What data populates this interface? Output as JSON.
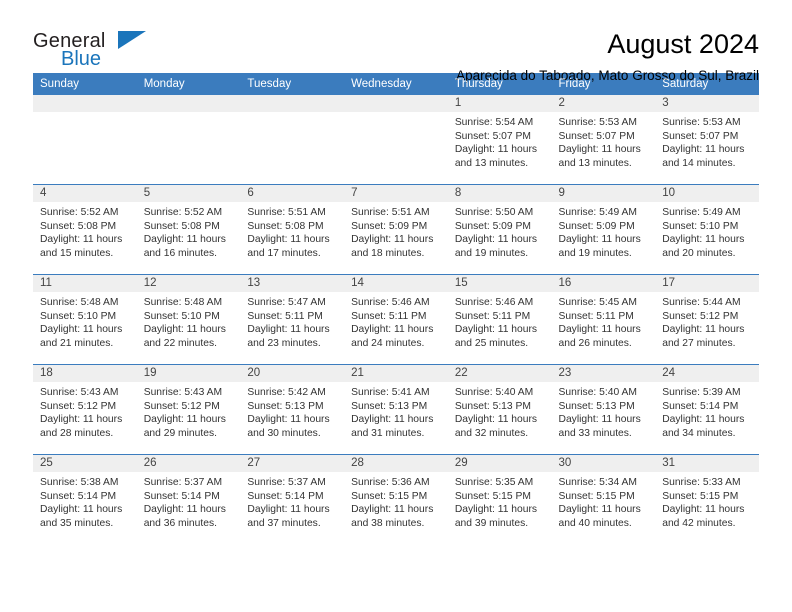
{
  "brand": {
    "word_one": "General",
    "word_two": "Blue",
    "triangle_icon": "triangle-icon"
  },
  "header": {
    "title": "August 2024",
    "subtitle": "Aparecida do Taboado, Mato Grosso do Sul, Brazil"
  },
  "colors": {
    "header_blue": "#3b7cbe",
    "daynum_strip": "#efefef",
    "brand_blue": "#1b75bb",
    "text": "#333333"
  },
  "calendar": {
    "weekday_headers": [
      "Sunday",
      "Monday",
      "Tuesday",
      "Wednesday",
      "Thursday",
      "Friday",
      "Saturday"
    ],
    "weeks": [
      [
        {
          "day": "",
          "empty": true,
          "sunrise": "",
          "sunset": "",
          "daylight_line1": "",
          "daylight_line2": ""
        },
        {
          "day": "",
          "empty": true,
          "sunrise": "",
          "sunset": "",
          "daylight_line1": "",
          "daylight_line2": ""
        },
        {
          "day": "",
          "empty": true,
          "sunrise": "",
          "sunset": "",
          "daylight_line1": "",
          "daylight_line2": ""
        },
        {
          "day": "",
          "empty": true,
          "sunrise": "",
          "sunset": "",
          "daylight_line1": "",
          "daylight_line2": ""
        },
        {
          "day": "1",
          "empty": false,
          "sunrise": "Sunrise: 5:54 AM",
          "sunset": "Sunset: 5:07 PM",
          "daylight_line1": "Daylight: 11 hours",
          "daylight_line2": "and 13 minutes."
        },
        {
          "day": "2",
          "empty": false,
          "sunrise": "Sunrise: 5:53 AM",
          "sunset": "Sunset: 5:07 PM",
          "daylight_line1": "Daylight: 11 hours",
          "daylight_line2": "and 13 minutes."
        },
        {
          "day": "3",
          "empty": false,
          "sunrise": "Sunrise: 5:53 AM",
          "sunset": "Sunset: 5:07 PM",
          "daylight_line1": "Daylight: 11 hours",
          "daylight_line2": "and 14 minutes."
        }
      ],
      [
        {
          "day": "4",
          "empty": false,
          "sunrise": "Sunrise: 5:52 AM",
          "sunset": "Sunset: 5:08 PM",
          "daylight_line1": "Daylight: 11 hours",
          "daylight_line2": "and 15 minutes."
        },
        {
          "day": "5",
          "empty": false,
          "sunrise": "Sunrise: 5:52 AM",
          "sunset": "Sunset: 5:08 PM",
          "daylight_line1": "Daylight: 11 hours",
          "daylight_line2": "and 16 minutes."
        },
        {
          "day": "6",
          "empty": false,
          "sunrise": "Sunrise: 5:51 AM",
          "sunset": "Sunset: 5:08 PM",
          "daylight_line1": "Daylight: 11 hours",
          "daylight_line2": "and 17 minutes."
        },
        {
          "day": "7",
          "empty": false,
          "sunrise": "Sunrise: 5:51 AM",
          "sunset": "Sunset: 5:09 PM",
          "daylight_line1": "Daylight: 11 hours",
          "daylight_line2": "and 18 minutes."
        },
        {
          "day": "8",
          "empty": false,
          "sunrise": "Sunrise: 5:50 AM",
          "sunset": "Sunset: 5:09 PM",
          "daylight_line1": "Daylight: 11 hours",
          "daylight_line2": "and 19 minutes."
        },
        {
          "day": "9",
          "empty": false,
          "sunrise": "Sunrise: 5:49 AM",
          "sunset": "Sunset: 5:09 PM",
          "daylight_line1": "Daylight: 11 hours",
          "daylight_line2": "and 19 minutes."
        },
        {
          "day": "10",
          "empty": false,
          "sunrise": "Sunrise: 5:49 AM",
          "sunset": "Sunset: 5:10 PM",
          "daylight_line1": "Daylight: 11 hours",
          "daylight_line2": "and 20 minutes."
        }
      ],
      [
        {
          "day": "11",
          "empty": false,
          "sunrise": "Sunrise: 5:48 AM",
          "sunset": "Sunset: 5:10 PM",
          "daylight_line1": "Daylight: 11 hours",
          "daylight_line2": "and 21 minutes."
        },
        {
          "day": "12",
          "empty": false,
          "sunrise": "Sunrise: 5:48 AM",
          "sunset": "Sunset: 5:10 PM",
          "daylight_line1": "Daylight: 11 hours",
          "daylight_line2": "and 22 minutes."
        },
        {
          "day": "13",
          "empty": false,
          "sunrise": "Sunrise: 5:47 AM",
          "sunset": "Sunset: 5:11 PM",
          "daylight_line1": "Daylight: 11 hours",
          "daylight_line2": "and 23 minutes."
        },
        {
          "day": "14",
          "empty": false,
          "sunrise": "Sunrise: 5:46 AM",
          "sunset": "Sunset: 5:11 PM",
          "daylight_line1": "Daylight: 11 hours",
          "daylight_line2": "and 24 minutes."
        },
        {
          "day": "15",
          "empty": false,
          "sunrise": "Sunrise: 5:46 AM",
          "sunset": "Sunset: 5:11 PM",
          "daylight_line1": "Daylight: 11 hours",
          "daylight_line2": "and 25 minutes."
        },
        {
          "day": "16",
          "empty": false,
          "sunrise": "Sunrise: 5:45 AM",
          "sunset": "Sunset: 5:11 PM",
          "daylight_line1": "Daylight: 11 hours",
          "daylight_line2": "and 26 minutes."
        },
        {
          "day": "17",
          "empty": false,
          "sunrise": "Sunrise: 5:44 AM",
          "sunset": "Sunset: 5:12 PM",
          "daylight_line1": "Daylight: 11 hours",
          "daylight_line2": "and 27 minutes."
        }
      ],
      [
        {
          "day": "18",
          "empty": false,
          "sunrise": "Sunrise: 5:43 AM",
          "sunset": "Sunset: 5:12 PM",
          "daylight_line1": "Daylight: 11 hours",
          "daylight_line2": "and 28 minutes."
        },
        {
          "day": "19",
          "empty": false,
          "sunrise": "Sunrise: 5:43 AM",
          "sunset": "Sunset: 5:12 PM",
          "daylight_line1": "Daylight: 11 hours",
          "daylight_line2": "and 29 minutes."
        },
        {
          "day": "20",
          "empty": false,
          "sunrise": "Sunrise: 5:42 AM",
          "sunset": "Sunset: 5:13 PM",
          "daylight_line1": "Daylight: 11 hours",
          "daylight_line2": "and 30 minutes."
        },
        {
          "day": "21",
          "empty": false,
          "sunrise": "Sunrise: 5:41 AM",
          "sunset": "Sunset: 5:13 PM",
          "daylight_line1": "Daylight: 11 hours",
          "daylight_line2": "and 31 minutes."
        },
        {
          "day": "22",
          "empty": false,
          "sunrise": "Sunrise: 5:40 AM",
          "sunset": "Sunset: 5:13 PM",
          "daylight_line1": "Daylight: 11 hours",
          "daylight_line2": "and 32 minutes."
        },
        {
          "day": "23",
          "empty": false,
          "sunrise": "Sunrise: 5:40 AM",
          "sunset": "Sunset: 5:13 PM",
          "daylight_line1": "Daylight: 11 hours",
          "daylight_line2": "and 33 minutes."
        },
        {
          "day": "24",
          "empty": false,
          "sunrise": "Sunrise: 5:39 AM",
          "sunset": "Sunset: 5:14 PM",
          "daylight_line1": "Daylight: 11 hours",
          "daylight_line2": "and 34 minutes."
        }
      ],
      [
        {
          "day": "25",
          "empty": false,
          "sunrise": "Sunrise: 5:38 AM",
          "sunset": "Sunset: 5:14 PM",
          "daylight_line1": "Daylight: 11 hours",
          "daylight_line2": "and 35 minutes."
        },
        {
          "day": "26",
          "empty": false,
          "sunrise": "Sunrise: 5:37 AM",
          "sunset": "Sunset: 5:14 PM",
          "daylight_line1": "Daylight: 11 hours",
          "daylight_line2": "and 36 minutes."
        },
        {
          "day": "27",
          "empty": false,
          "sunrise": "Sunrise: 5:37 AM",
          "sunset": "Sunset: 5:14 PM",
          "daylight_line1": "Daylight: 11 hours",
          "daylight_line2": "and 37 minutes."
        },
        {
          "day": "28",
          "empty": false,
          "sunrise": "Sunrise: 5:36 AM",
          "sunset": "Sunset: 5:15 PM",
          "daylight_line1": "Daylight: 11 hours",
          "daylight_line2": "and 38 minutes."
        },
        {
          "day": "29",
          "empty": false,
          "sunrise": "Sunrise: 5:35 AM",
          "sunset": "Sunset: 5:15 PM",
          "daylight_line1": "Daylight: 11 hours",
          "daylight_line2": "and 39 minutes."
        },
        {
          "day": "30",
          "empty": false,
          "sunrise": "Sunrise: 5:34 AM",
          "sunset": "Sunset: 5:15 PM",
          "daylight_line1": "Daylight: 11 hours",
          "daylight_line2": "and 40 minutes."
        },
        {
          "day": "31",
          "empty": false,
          "sunrise": "Sunrise: 5:33 AM",
          "sunset": "Sunset: 5:15 PM",
          "daylight_line1": "Daylight: 11 hours",
          "daylight_line2": "and 42 minutes."
        }
      ]
    ]
  }
}
